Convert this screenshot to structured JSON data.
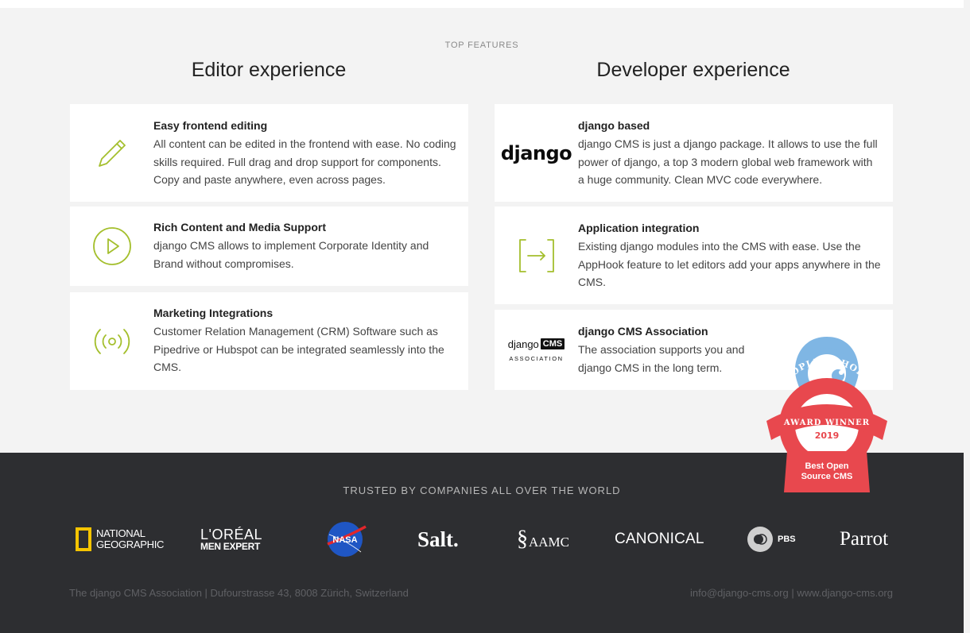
{
  "features": {
    "eyebrow": "TOP FEATURES",
    "editor_title": "Editor experience",
    "developer_title": "Developer experience",
    "editor_cards": [
      {
        "title": "Easy frontend editing",
        "text": "All content can be edited in the frontend with ease. No coding skills required. Full drag and drop support for components. Copy and paste anywhere, even across pages.",
        "icon": "pencil-icon"
      },
      {
        "title": "Rich Content and Media Support",
        "text": "django CMS allows to implement Corporate Identity and Brand without compromises.",
        "icon": "play-icon"
      },
      {
        "title": "Marketing Integrations",
        "text": "Customer Relation Management (CRM) Software such as Pipedrive or Hubspot can be integrated seamlessly into the CMS.",
        "icon": "broadcast-icon"
      }
    ],
    "developer_cards": [
      {
        "title": "django based",
        "text": "django CMS is just a django package. It allows to use the full power of django, a top 3 modern global web framework with a huge community. Clean MVC code everywhere.",
        "logo_text": "django"
      },
      {
        "title": "Application integration",
        "text": "Existing django modules into the CMS with ease. Use the AppHook feature to let editors add your apps anywhere in the CMS.",
        "icon": "app-integration-icon"
      },
      {
        "title": "django CMS Association",
        "text": "The association supports you and django CMS in the long term.",
        "logo_word": "django",
        "logo_cms": "CMS",
        "logo_sub": "ASSOCIATION"
      }
    ]
  },
  "badge": {
    "line1": "PEOPLES CHOICE",
    "line2": "AWARD WINNER",
    "year": "2019",
    "ribbon1": "Best Open",
    "ribbon2": "Source CMS"
  },
  "footer": {
    "heading": "TRUSTED BY COMPANIES ALL OVER THE WORLD",
    "logos": {
      "natgeo_1": "NATIONAL",
      "natgeo_2": "GEOGRAPHIC",
      "loreal_1": "L'ORÉAL",
      "loreal_2": "MEN EXPERT",
      "nasa": "NASA",
      "salt": "Salt.",
      "aamc": "AAMC",
      "canonical": "CANONICAL",
      "pbs": "PBS",
      "parrot": "Parrot"
    },
    "address": "The django CMS Association | Dufourstrasse 43, 8008 Zürich, Switzerland",
    "contact": "info@django-cms.org | www.django-cms.org"
  },
  "colors": {
    "accent_green": "#a4bf2d",
    "footer_bg": "#2d2e31",
    "badge_red": "#e8484e",
    "badge_blue": "#7fb6e4"
  }
}
